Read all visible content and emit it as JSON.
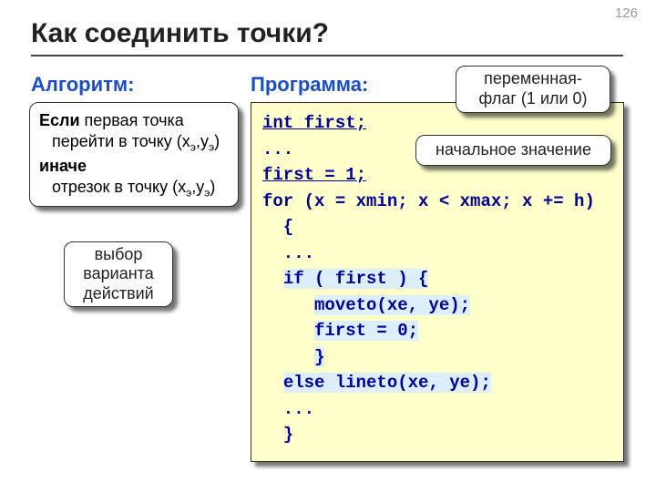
{
  "page_number": "126",
  "title": "Как соединить точки?",
  "labels": {
    "algorithm": "Алгоритм:",
    "program": "Программа:"
  },
  "algorithm": {
    "if_kw": "Если ",
    "if_text": "первая точка",
    "then_text": "перейти в точку (x",
    "sub": "э",
    "then_text2": ",y",
    "then_text3": ")",
    "else_kw": "иначе",
    "else_text": "отрезок в точку (x",
    "else_text2": ",y",
    "else_text3": ")"
  },
  "callouts": {
    "choice": "выбор варианта действий",
    "flag": "переменная-флаг (1 или 0)",
    "init": "начальное значение"
  },
  "code": {
    "l1": "int first;",
    "l2": "...",
    "l3": "first = 1;",
    "l4": "for (x = xmin; x < xmax; x += h)",
    "l5": "  {",
    "l6": "  ...",
    "l7a": "  ",
    "l7b": "if ( first ) {",
    "l8a": "     ",
    "l8b": "moveto(xe, ye);",
    "l9a": "     ",
    "l9b": "first = 0;",
    "l10a": "     ",
    "l10b": "}",
    "l11a": "  ",
    "l11b": "else lineto(xe, ye);",
    "l12": "  ...",
    "l13": "  }"
  }
}
